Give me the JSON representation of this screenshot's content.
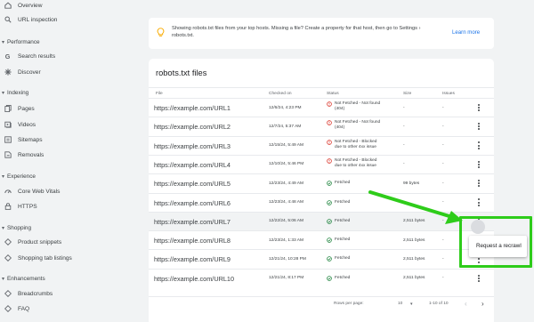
{
  "sidebar": {
    "items": [
      {
        "label": "Overview",
        "icon": "home-icon",
        "top": 0
      },
      {
        "label": "URL inspection",
        "icon": "search-icon",
        "top": 0
      }
    ],
    "sections": [
      {
        "label": "Performance"
      },
      {
        "label": "Indexing"
      },
      {
        "label": "Experience"
      },
      {
        "label": "Shopping"
      },
      {
        "label": "Enhancements"
      }
    ],
    "nav": {
      "overview": "Overview",
      "url_inspection": "URL inspection",
      "performance": "Performance",
      "search_results": "Search results",
      "discover": "Discover",
      "indexing": "Indexing",
      "pages": "Pages",
      "videos": "Videos",
      "sitemaps": "Sitemaps",
      "removals": "Removals",
      "experience": "Experience",
      "cwv": "Core Web Vitals",
      "https": "HTTPS",
      "shopping": "Shopping",
      "product_snippets": "Product snippets",
      "shopping_tab": "Shopping tab listings",
      "enhancements": "Enhancements",
      "breadcrumbs": "Breadcrumbs",
      "faq": "FAQ"
    }
  },
  "banner": {
    "message": "Showing robots.txt files from your top hosts. Missing a file? Create a property for that host, then go to Settings › robots.txt.",
    "learn_more": "Learn more"
  },
  "card": {
    "title": "robots.txt files",
    "columns": {
      "file": "File",
      "checked": "Checked on",
      "status": "Status",
      "size": "Size",
      "issues": "Issues"
    },
    "rows": [
      {
        "file": "https://example.com/URL1",
        "checked": "12/6/24, 4:23 PM",
        "status_l1": "Not Fetched - Not found",
        "status_l2": "(404)",
        "status_type": "error",
        "size": "-",
        "issues": "-"
      },
      {
        "file": "https://example.com/URL2",
        "checked": "12/7/24, 5:37 AM",
        "status_l1": "Not Fetched - Not found",
        "status_l2": "(404)",
        "status_type": "error",
        "size": "-",
        "issues": "-"
      },
      {
        "file": "https://example.com/URL3",
        "checked": "12/15/24, 5:49 AM",
        "status_l1": "Not Fetched - Blocked",
        "status_l2": "due to other 4xx issue",
        "status_type": "error",
        "size": "-",
        "issues": "-"
      },
      {
        "file": "https://example.com/URL4",
        "checked": "12/10/24, 5:46 PM",
        "status_l1": "Not Fetched - Blocked",
        "status_l2": "due to other 4xx issue",
        "status_type": "error",
        "size": "-",
        "issues": "-"
      },
      {
        "file": "https://example.com/URL5",
        "checked": "12/23/24, 4:49 AM",
        "status_l1": "Fetched",
        "status_l2": "",
        "status_type": "ok",
        "size": "99 bytes",
        "issues": "-"
      },
      {
        "file": "https://example.com/URL6",
        "checked": "12/23/24, 4:48 AM",
        "status_l1": "Fetched",
        "status_l2": "",
        "status_type": "ok",
        "size": "-",
        "issues": "-"
      },
      {
        "file": "https://example.com/URL7",
        "checked": "12/22/24, 5:06 AM",
        "status_l1": "Fetched",
        "status_l2": "",
        "status_type": "ok",
        "size": "2,511 bytes",
        "issues": "-"
      },
      {
        "file": "https://example.com/URL8",
        "checked": "12/23/24, 1:33 AM",
        "status_l1": "Fetched",
        "status_l2": "",
        "status_type": "ok",
        "size": "2,511 bytes",
        "issues": "-"
      },
      {
        "file": "https://example.com/URL9",
        "checked": "12/21/24, 10:28 PM",
        "status_l1": "Fetched",
        "status_l2": "",
        "status_type": "ok",
        "size": "2,511 bytes",
        "issues": "-"
      },
      {
        "file": "https://example.com/URL10",
        "checked": "12/21/24, 8:17 PM",
        "status_l1": "Fetched",
        "status_l2": "",
        "status_type": "ok",
        "size": "2,511 bytes",
        "issues": "-"
      }
    ],
    "footer": {
      "rows_per_page_label": "Rows per page:",
      "rows_per_page": "10",
      "range": "1-10 of 10"
    }
  },
  "menu": {
    "request_recrawl": "Request a recrawl"
  },
  "colors": {
    "accent": "#1a73e8",
    "error": "#d93025",
    "ok": "#188038",
    "highlight": "#2ecc1a"
  }
}
